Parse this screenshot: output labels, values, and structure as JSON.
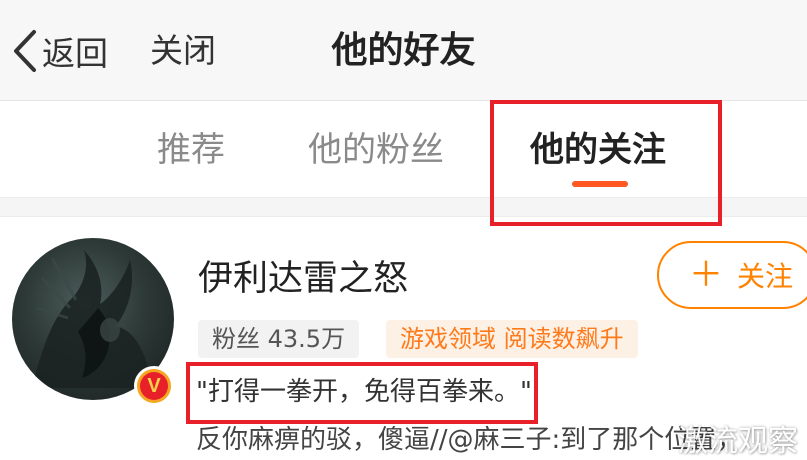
{
  "header": {
    "back_label": "返回",
    "close_label": "关闭",
    "title": "他的好友"
  },
  "tabs": [
    {
      "label": "推荐",
      "active": false
    },
    {
      "label": "他的粉丝",
      "active": false
    },
    {
      "label": "他的关注",
      "active": true
    }
  ],
  "user": {
    "name": "伊利达雷之怒",
    "follow_label": "关注",
    "fans": "粉丝 43.5万",
    "tag": "游戏领域 阅读数飙升",
    "verified_badge": "V",
    "quote": "\"打得一拳开，免得百拳来。\"",
    "description": "反你麻痹的驳，傻逼//@麻三子:到了那个位置，"
  },
  "watermark": "激流观察",
  "colors": {
    "accent": "#ff5722",
    "follow": "#ff8200",
    "highlight": "#e8202a",
    "tag_text": "#ff7a1a"
  }
}
